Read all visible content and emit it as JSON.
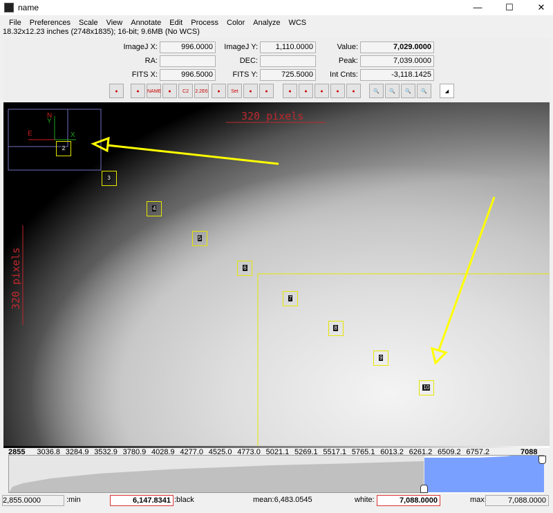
{
  "window": {
    "title": "name",
    "minimize": "—",
    "maximize": "☐",
    "close": "✕"
  },
  "menu": [
    "File",
    "Preferences",
    "Scale",
    "View",
    "Annotate",
    "Edit",
    "Process",
    "Color",
    "Analyze",
    "WCS"
  ],
  "info": "18.32x12.23 inches (2748x1835); 16-bit; 9.6MB (No WCS)",
  "readouts": {
    "imagej_x_label": "ImageJ X:",
    "imagej_x": "996.0000",
    "imagej_y_label": "ImageJ Y:",
    "imagej_y": "1,110.0000",
    "value_label": "Value:",
    "value": "7,029.0000",
    "ra_label": "RA:",
    "ra": "",
    "dec_label": "DEC:",
    "dec": "",
    "peak_label": "Peak:",
    "peak": "7,039.0000",
    "fits_x_label": "FITS X:",
    "fits_x": "996.5000",
    "fits_y_label": "FITS Y:",
    "fits_y": "725.5000",
    "intcnts_label": "Int Cnts:",
    "intcnts": "-3,118.1425"
  },
  "toolbar": [
    {
      "icon": "clear-overlay-icon",
      "label": ""
    },
    {
      "icon": "invert-colors-icon",
      "label": ""
    },
    {
      "icon": "show-names-icon",
      "label": "NAME"
    },
    {
      "icon": "aperture-icon",
      "label": ""
    },
    {
      "icon": "centroid-c2-icon",
      "label": "C2"
    },
    {
      "icon": "centroid-2-2e6-icon",
      "label": "2.2E6"
    },
    {
      "icon": "multi-aperture-icon",
      "label": ""
    },
    {
      "icon": "set-aperture-icon",
      "label": "Set"
    },
    {
      "icon": "edit-aperture-icon",
      "label": ""
    },
    {
      "icon": "clear-apertures-icon",
      "label": ""
    },
    {
      "icon": "broom-icon",
      "label": ""
    },
    {
      "icon": "astrometry-icon",
      "label": ""
    },
    {
      "icon": "filter-icon",
      "label": ""
    },
    {
      "icon": "crosshair-icon",
      "label": ""
    },
    {
      "icon": "table-icon",
      "label": ""
    },
    {
      "icon": "zoom-in-icon",
      "label": ""
    },
    {
      "icon": "zoom-in-small-icon",
      "label": ""
    },
    {
      "icon": "zoom-out-icon",
      "label": ""
    },
    {
      "icon": "zoom-fit-icon",
      "label": ""
    },
    {
      "icon": "contrast-icon",
      "label": ""
    }
  ],
  "image": {
    "scale_bar": "320 pixels",
    "compass": {
      "n": "N",
      "e": "E",
      "x": "X",
      "y": "Y"
    },
    "markers": [
      "2",
      "3",
      "4",
      "5",
      "6",
      "7",
      "8",
      "9",
      "10"
    ],
    "arrow_color": "#ffff00",
    "marker_color": "#e6e600",
    "scale_color": "#c0282d"
  },
  "histogram": {
    "ticks": [
      "2855",
      "3036.8",
      "3284.9",
      "3532.9",
      "3780.9",
      "4028.9",
      "4277.0",
      "4525.0",
      "4773.0",
      "5021.1",
      "5269.1",
      "5517.1",
      "5765.1",
      "6013.2",
      "6261.2",
      "6509.2",
      "6757.2",
      "7088"
    ],
    "min_value": "2,855.0000",
    "min_label": ":min",
    "black_value": "6,147.8341",
    "black_label": ":black",
    "mean": "mean:6,483.0545",
    "white_label": "white:",
    "white_value": "7,088.0000",
    "max_label": "max:",
    "max_value": "7,088.0000",
    "selected_color": "#7aa0ff"
  }
}
